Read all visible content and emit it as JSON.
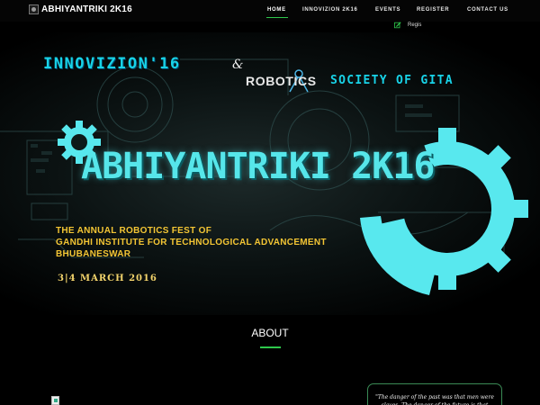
{
  "brand": {
    "title": "ABHIYANTRIKI 2K16"
  },
  "nav": {
    "items": [
      "HOME",
      "INNOVIZION 2K16",
      "EVENTS",
      "REGISTER",
      "CONTACT US"
    ],
    "active": "HOME",
    "sub_link": "Regis"
  },
  "hero": {
    "innovizion": "INNOVIZION'16",
    "amp": "&",
    "robotics": "ROBOTICS",
    "society": "SOCIETY OF GITA",
    "main_title": "ABHIYANTRIKI 2K16",
    "tagline": [
      "THE ANNUAL ROBOTICS FEST OF",
      "GANDHI INSTITUTE FOR TECHNOLOGICAL ADVANCEMENT",
      "BHUBANESWAR"
    ],
    "date": "3|4 MARCH 2016"
  },
  "about": {
    "heading": "ABOUT",
    "quote": "\"The danger of the past was that men were slaves. The danger of the future is that"
  },
  "colors": {
    "accent_green": "#2ec84b",
    "title_cyan": "#18d3e8",
    "gear_cyan": "#58e8ee",
    "tagline_gold": "#f3c534"
  },
  "icons": {
    "register_sub": "edit-icon"
  }
}
